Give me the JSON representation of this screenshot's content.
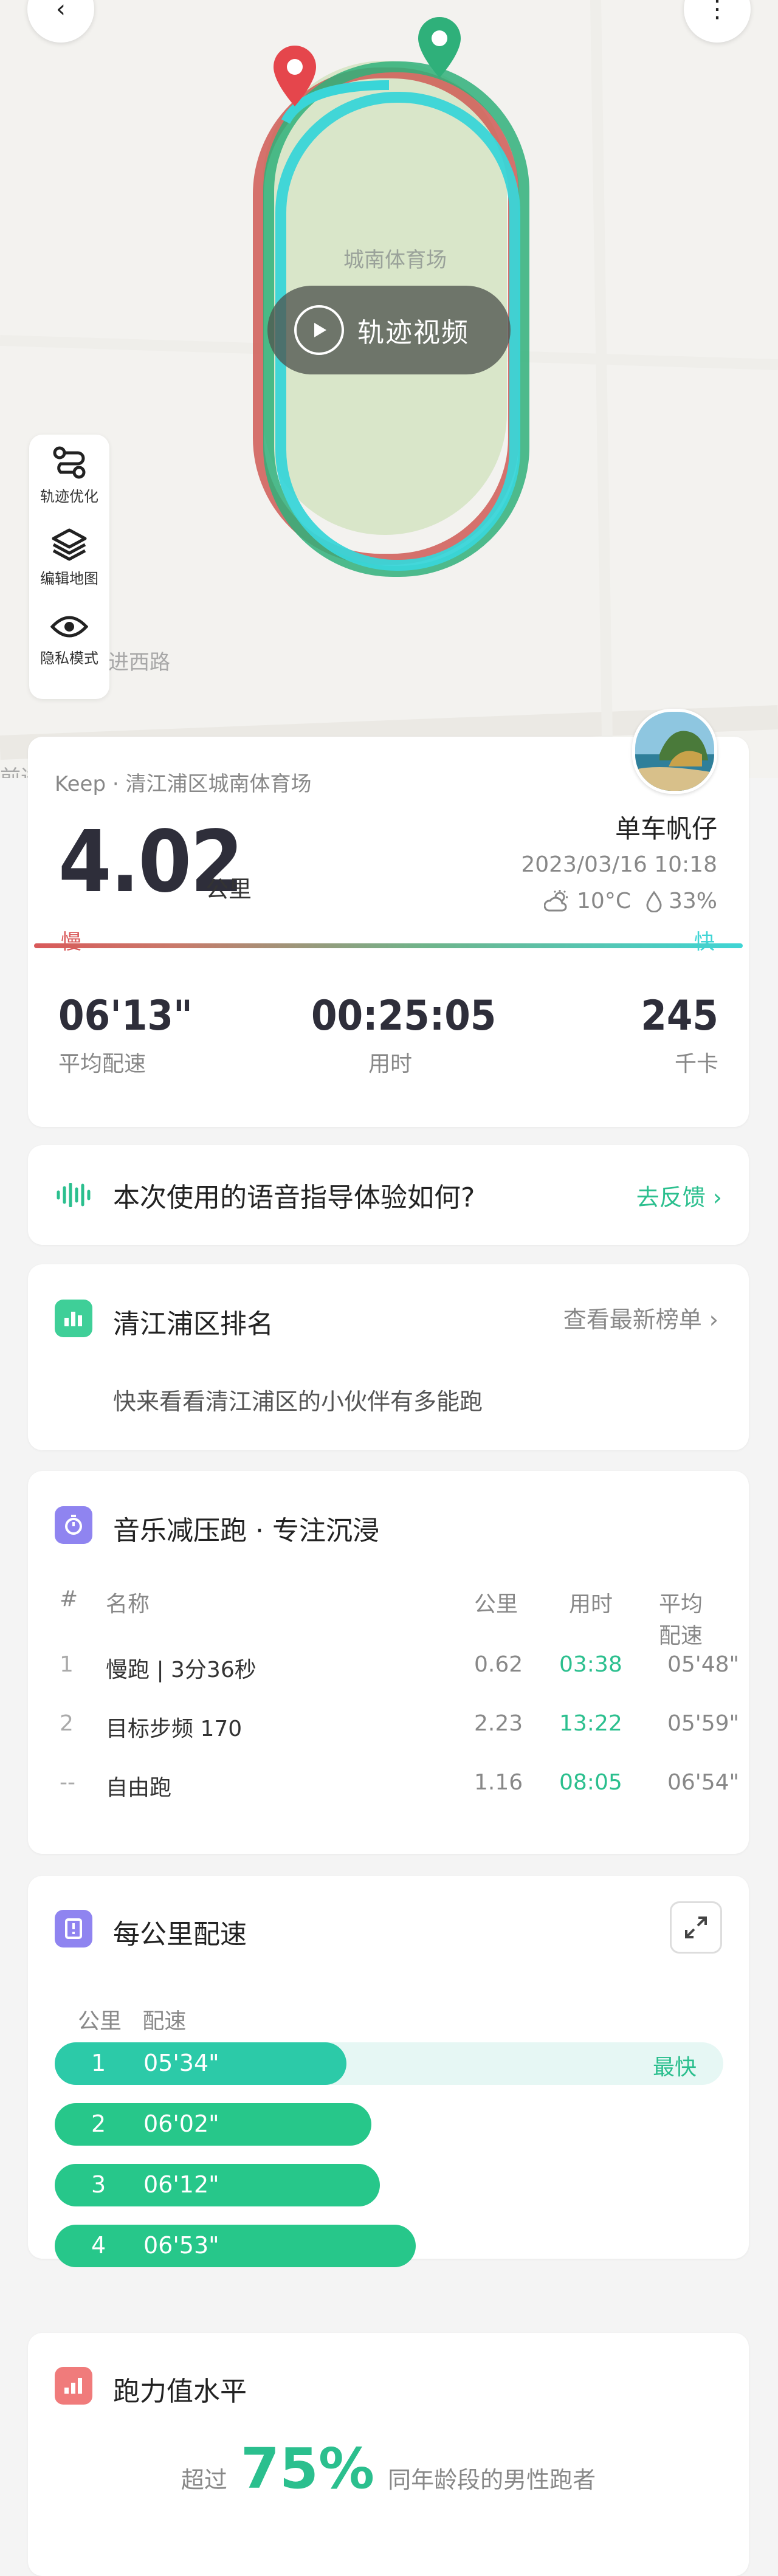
{
  "map": {
    "venue_label": "城南体育场",
    "road_label_1": "进西路",
    "road_label_2": "前进",
    "road_label_3": "前进",
    "video_button": "轨迹视频",
    "tools": [
      {
        "label": "轨迹优化",
        "icon": "route-optimize-icon"
      },
      {
        "label": "编辑地图",
        "icon": "layers-icon"
      },
      {
        "label": "隐私模式",
        "icon": "eye-icon"
      }
    ],
    "colors": {
      "park": "#dbe6cc",
      "track_cyan": "#39d5d8",
      "track_green": "#2fb07a",
      "track_red": "#cf5a55"
    }
  },
  "summary": {
    "source": "Keep · 清江浦区城南体育场",
    "distance": "4.02",
    "distance_unit": "公里",
    "user_name": "单车帆仔",
    "datetime": "2023/03/16 10:18",
    "temperature": "10°C",
    "humidity": "33%",
    "slow_label": "慢",
    "fast_label": "快",
    "stats": [
      {
        "value": "06'13\"",
        "label": "平均配速"
      },
      {
        "value": "00:25:05",
        "label": "用时"
      },
      {
        "value": "245",
        "label": "千卡"
      }
    ]
  },
  "feedback": {
    "question": "本次使用的语音指导体验如何?",
    "action": "去反馈"
  },
  "ranking": {
    "title": "清江浦区排名",
    "more": "查看最新榜单",
    "description": "快来看看清江浦区的小伙伴有多能跑"
  },
  "music": {
    "title": "音乐减压跑 · 专注沉浸",
    "headers": [
      "#",
      "名称",
      "公里",
      "用时",
      "平均配速"
    ],
    "rows": [
      {
        "idx": "1",
        "name": "慢跑 | 3分36秒",
        "km": "0.62",
        "time": "03:38",
        "pace": "05'48\""
      },
      {
        "idx": "2",
        "name": "目标步频 170",
        "km": "2.23",
        "time": "13:22",
        "pace": "05'59\""
      },
      {
        "idx": "--",
        "name": "自由跑",
        "km": "1.16",
        "time": "08:05",
        "pace": "06'54\""
      }
    ]
  },
  "per_km": {
    "title": "每公里配速",
    "header_km": "公里",
    "header_pace": "配速",
    "fastest_label": "最快",
    "rows": [
      {
        "km": "1",
        "pace": "05'34\"",
        "seconds": 334
      },
      {
        "km": "2",
        "pace": "06'02\"",
        "seconds": 362
      },
      {
        "km": "3",
        "pace": "06'12\"",
        "seconds": 372
      },
      {
        "km": "4",
        "pace": "06'53\"",
        "seconds": 413
      }
    ]
  },
  "ability": {
    "title": "跑力值水平",
    "prefix": "超过",
    "percent": "75%",
    "suffix": "同年龄段的男性跑者"
  },
  "accent": "#2bbf8e"
}
